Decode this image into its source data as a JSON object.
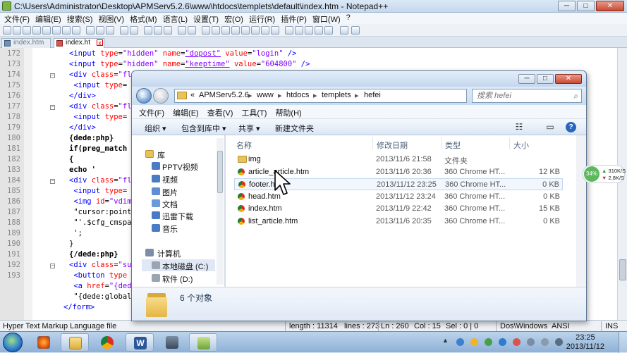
{
  "notepad": {
    "title": "C:\\Users\\Administrator\\Desktop\\APMServ5.2.6\\www\\htdocs\\templets\\default\\index.htm - Notepad++",
    "caption": {
      "minimize": "─",
      "maximize": "□",
      "close": "✕"
    },
    "menu": [
      "文件(F)",
      "编辑(E)",
      "搜索(S)",
      "视图(V)",
      "格式(M)",
      "语言(L)",
      "设置(T)",
      "宏(O)",
      "运行(R)",
      "插件(P)",
      "窗口(W)",
      "?"
    ],
    "tabs": [
      {
        "label": "index.htm"
      },
      {
        "label": "index.ht",
        "close": "x"
      }
    ],
    "line_numbers": [
      "172",
      "173",
      "174",
      "175",
      "176",
      "177",
      "178",
      "179",
      "180",
      "181",
      "182",
      "183",
      "184",
      "185",
      "186",
      "187",
      "188",
      "189",
      "190",
      "191",
      "192",
      "193"
    ],
    "code_lines": [
      [
        "<input ",
        "type",
        "=",
        "\"hidden\"",
        " ",
        "name",
        "=",
        "\"dopost\"",
        " ",
        "value",
        "=",
        "\"login\"",
        " />"
      ],
      [
        "<input ",
        "type",
        "=",
        "\"hidden\"",
        " ",
        "name",
        "=",
        "\"keeptime\"",
        " ",
        "value",
        "=",
        "\"604800\"",
        " />"
      ],
      [
        "<div ",
        "class",
        "=",
        "\"fl"
      ],
      [
        " <input ",
        "type",
        "="
      ],
      [
        "</div>"
      ],
      [
        "<div ",
        "class",
        "=",
        "\"fl"
      ],
      [
        " <input ",
        "type",
        "="
      ],
      [
        "</div>"
      ],
      [
        "{dede:php}"
      ],
      [
        "if(preg_match"
      ],
      [
        "{"
      ],
      [
        "echo '"
      ],
      [
        "<div ",
        "class",
        "=",
        "\"fl"
      ],
      [
        " <input ",
        "type",
        "="
      ],
      [
        " <img ",
        "id",
        "=",
        "\"vdim"
      ],
      [
        " \"cursor:point"
      ],
      [
        " \"'.$cfg_cmspa"
      ],
      [
        " ';"
      ],
      [
        "}"
      ],
      [
        "{/dede:php}"
      ],
      [
        "<div ",
        "class",
        "=",
        "\"su"
      ],
      [
        " <button ",
        "type"
      ],
      [
        " <a ",
        "href",
        "=",
        "\"{ded"
      ],
      [
        " \"{dede:global"
      ],
      [
        "</form>"
      ]
    ],
    "status": {
      "lang": "Hyper Text Markup Language file",
      "length": "length : 11314",
      "lines": "lines : 273",
      "ln": "Ln : 260",
      "col": "Col : 15",
      "sel": "Sel : 0 | 0",
      "eol": "Dos\\Windows",
      "enc": "ANSI",
      "ins": "INS"
    }
  },
  "explorer": {
    "caption": {
      "minimize": "─",
      "maximize": "□",
      "close": "✕"
    },
    "nav": {
      "back": "←",
      "forward": "→"
    },
    "breadcrumb": [
      "«",
      "APMServ5.2.6",
      "▸",
      "www",
      "▸",
      "htdocs",
      "▸",
      "templets",
      "▸",
      "hefei"
    ],
    "search_placeholder": "搜索 hefei",
    "menu": [
      "文件(F)",
      "编辑(E)",
      "查看(V)",
      "工具(T)",
      "帮助(H)"
    ],
    "commands": [
      "组织 ▾",
      "包含到库中 ▾",
      "共享 ▾",
      "新建文件夹"
    ],
    "columns": {
      "name": "名称",
      "date": "修改日期",
      "type": "类型",
      "size": "大小"
    },
    "nav_tree": [
      {
        "label": "库"
      },
      {
        "label": "PPTV视频"
      },
      {
        "label": "视频"
      },
      {
        "label": "图片"
      },
      {
        "label": "文档"
      },
      {
        "label": "迅雷下载"
      },
      {
        "label": "音乐"
      },
      {
        "label": "计算机"
      },
      {
        "label": "本地磁盘 (C:)"
      },
      {
        "label": "软件 (D:)"
      }
    ],
    "files": [
      {
        "name": "img",
        "date": "2013/11/6 21:58",
        "type": "文件夹",
        "size": "",
        "kind": "folder"
      },
      {
        "name": "article_article.htm",
        "date": "2013/11/6 20:36",
        "type": "360 Chrome HT...",
        "size": "12 KB",
        "kind": "html"
      },
      {
        "name": "footer.htm",
        "date": "2013/11/12 23:25",
        "type": "360 Chrome HT...",
        "size": "0 KB",
        "kind": "html"
      },
      {
        "name": "head.htm",
        "date": "2013/11/12 23:24",
        "type": "360 Chrome HT...",
        "size": "0 KB",
        "kind": "html"
      },
      {
        "name": "index.htm",
        "date": "2013/11/9 22:42",
        "type": "360 Chrome HT...",
        "size": "15 KB",
        "kind": "html"
      },
      {
        "name": "list_article.htm",
        "date": "2013/11/6 20:35",
        "type": "360 Chrome HT...",
        "size": "0 KB",
        "kind": "html"
      }
    ],
    "details": "6 个对象"
  },
  "netwidget": {
    "percent": "34%",
    "up": "310K/S",
    "down": "2.8K/S",
    "up_arrow": "▲",
    "down_arrow": "▼"
  },
  "taskbar": {
    "time": "23:25",
    "date": "2013/11/12",
    "tray_arrow": "▲",
    "apps": [
      {
        "name": "firefox",
        "glyph": ""
      },
      {
        "name": "file-explorer",
        "glyph": ""
      },
      {
        "name": "chrome",
        "glyph": ""
      },
      {
        "name": "word",
        "glyph": "W"
      },
      {
        "name": "apmserv",
        "glyph": ""
      },
      {
        "name": "notepad-plus-plus",
        "glyph": ""
      }
    ]
  }
}
